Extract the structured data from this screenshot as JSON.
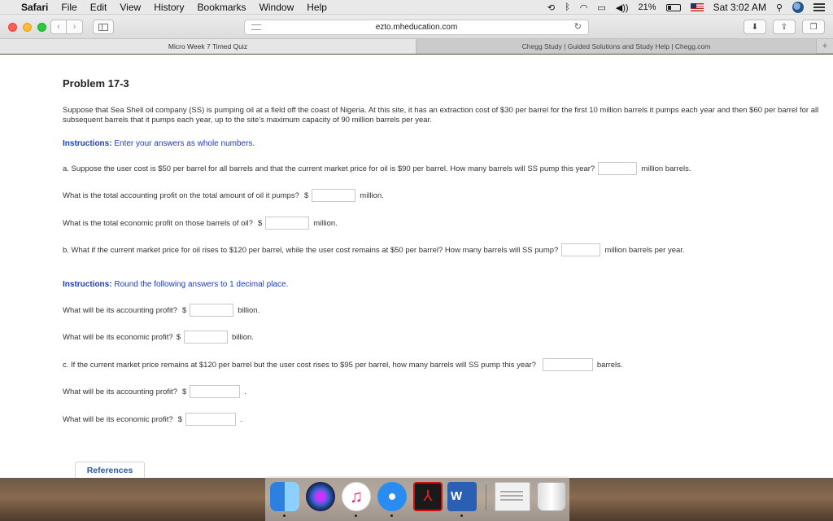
{
  "menubar": {
    "items": [
      "Safari",
      "File",
      "Edit",
      "View",
      "History",
      "Bookmarks",
      "Window",
      "Help"
    ],
    "battery": "21%",
    "clock": "Sat 3:02 AM"
  },
  "toolbar": {
    "url": "ezto.mheducation.com"
  },
  "tabs": [
    {
      "label": "Micro Week 7 Timed Quiz",
      "active": true
    },
    {
      "label": "Chegg Study | Guided Solutions and Study Help | Chegg.com",
      "active": false
    }
  ],
  "problem": {
    "title": "Problem 17-3",
    "text": "Suppose that Sea Shell oil company (SS) is pumping oil at a field off the coast of Nigeria. At this site, it has an extraction cost of $30 per barrel for the first 10 million barrels it pumps each year and then $60 per barrel for all subsequent barrels that it pumps each year, up to the site's maximum capacity of 90 million barrels per year.",
    "instructions1_label": "Instructions:",
    "instructions1_text": "Enter your answers as whole numbers.",
    "instructions2_label": "Instructions:",
    "instructions2_text": "Round the following answers to 1 decimal place.",
    "questions": [
      {
        "prefix": "a. Suppose the user cost is $50 per barrel for all barrels and that the current market price for oil is $90 per barrel. How many barrels will SS pump this year?",
        "dollar": "",
        "suffix": "million barrels.",
        "value": ""
      },
      {
        "prefix": "What is the total accounting profit on the total amount of oil it pumps?",
        "dollar": "$",
        "suffix": "million.",
        "value": ""
      },
      {
        "prefix": "What is the total economic profit on those barrels of oil?",
        "dollar": "$",
        "suffix": "million.",
        "value": ""
      },
      {
        "prefix": "b. What if the current market price for oil rises to $120 per barrel, while the user cost remains at $50 per barrel? How many barrels will SS pump?",
        "dollar": "",
        "suffix": "million barrels per year.",
        "value": ""
      },
      {
        "prefix": "What will be its accounting profit?",
        "dollar": "$",
        "suffix": "billion.",
        "value": ""
      },
      {
        "prefix": "What will be its economic profit?",
        "dollar": "$",
        "suffix": "billion.",
        "value": ""
      },
      {
        "prefix": "c. If the current market price remains at $120 per barrel but the user cost rises to $95 per barrel, how many barrels will SS pump this year?",
        "dollar": "",
        "suffix": "barrels.",
        "value": ""
      },
      {
        "prefix": "What will be its accounting profit?",
        "dollar": "$",
        "suffix": ".",
        "value": ""
      },
      {
        "prefix": "What will be its economic profit?",
        "dollar": "$",
        "suffix": ".",
        "value": ""
      }
    ],
    "references_label": "References"
  },
  "dock": {
    "word_letter": "W",
    "icons": [
      "finder-icon",
      "siri-icon",
      "itunes-icon",
      "safari-icon",
      "acrobat-icon",
      "word-icon",
      "preview-icon",
      "trash-icon"
    ]
  }
}
